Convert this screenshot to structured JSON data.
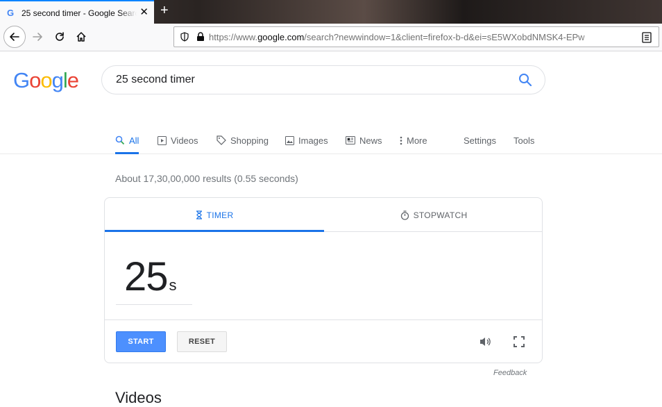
{
  "browser": {
    "tab_title": "25 second timer - Google Search",
    "tab_favicon": "G",
    "new_tab_symbol": "+",
    "url_prefix": "https://www.",
    "url_domain": "google.com",
    "url_rest": "/search?newwindow=1&client=firefox-b-d&ei=sE5WXobdNMSK4-EPw"
  },
  "search": {
    "logo": "Google",
    "query": "25 second timer"
  },
  "nav_tabs": {
    "all": "All",
    "videos": "Videos",
    "shopping": "Shopping",
    "images": "Images",
    "news": "News",
    "more": "More",
    "settings": "Settings",
    "tools": "Tools"
  },
  "results_count": "About 17,30,00,000 results (0.55 seconds)",
  "timer_card": {
    "tab_timer": "TIMER",
    "tab_stopwatch": "STOPWATCH",
    "value": "25",
    "unit": "s",
    "start_label": "START",
    "reset_label": "RESET"
  },
  "feedback": "Feedback",
  "videos_heading": "Videos",
  "colors": {
    "accent_blue": "#1a73e8",
    "start_button": "#4d90fe",
    "google_blue": "#4285f4",
    "google_red": "#ea4335",
    "google_yellow": "#fbbc05",
    "google_green": "#34a853"
  }
}
